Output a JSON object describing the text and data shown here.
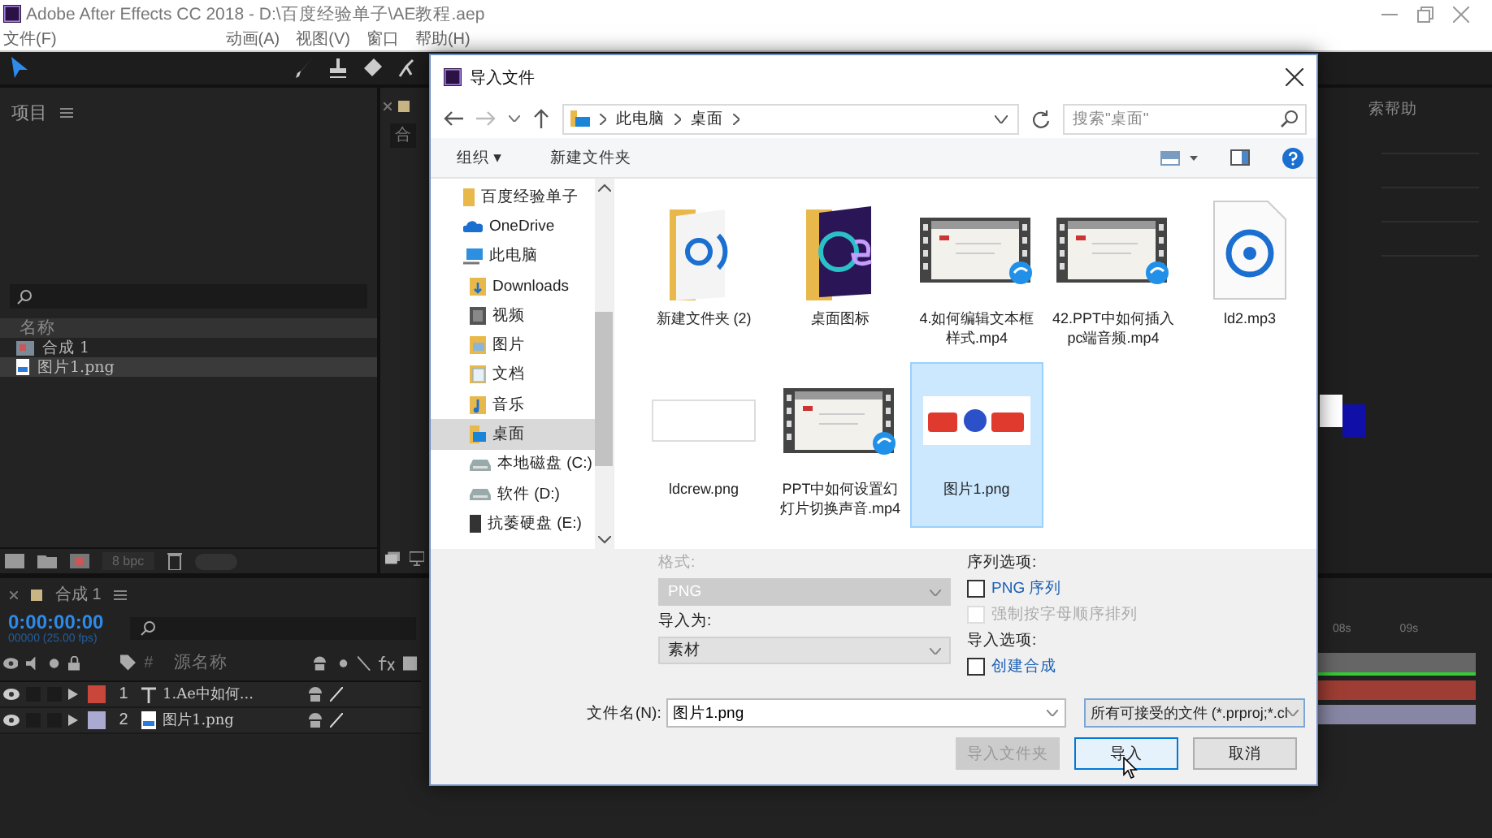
{
  "app": {
    "title": "Adobe After Effects CC 2018 - D:\\百度经验单子\\AE教程.aep"
  },
  "menu": [
    "文件(F)",
    "动画(A)",
    "视图(V)",
    "窗口",
    "帮助(H)"
  ],
  "project_panel": {
    "title": "项目",
    "columns": [
      "名称"
    ],
    "items": [
      {
        "name": "合成 1",
        "kind": "comp",
        "selected": false
      },
      {
        "name": "图片1.png",
        "kind": "image",
        "selected": true
      }
    ],
    "bit_depth": "8 bpc"
  },
  "comp_tab": "合",
  "right_panel": {
    "help_text": "索帮助",
    "ruler": [
      "08s",
      "09s"
    ]
  },
  "timeline": {
    "tab": "合成 1",
    "timecode": "0:00:00:00",
    "fps": "00000 (25.00 fps)",
    "columns": [
      "#",
      "源名称"
    ],
    "layers": [
      {
        "index": "1",
        "name": "1.Ae中如何...",
        "kind": "text",
        "color": "#c8473a"
      },
      {
        "index": "2",
        "name": "图片1.png",
        "kind": "image",
        "color": "#a9a9d2"
      }
    ]
  },
  "dialog": {
    "title": "导入文件",
    "breadcrumb": [
      "此电脑",
      "桌面"
    ],
    "search": {
      "placeholder": "搜索\"桌面\""
    },
    "toolbar": [
      "组织 ▾",
      "新建文件夹"
    ],
    "nav": [
      {
        "label": "百度经验单子",
        "kind": "folder",
        "selected": false
      },
      {
        "label": "OneDrive",
        "kind": "cloud",
        "selected": false
      },
      {
        "label": "此电脑",
        "kind": "pc",
        "selected": false,
        "children": [
          {
            "label": "Downloads",
            "kind": "download",
            "selected": false
          },
          {
            "label": "视频",
            "kind": "video",
            "selected": false
          },
          {
            "label": "图片",
            "kind": "picture",
            "selected": false
          },
          {
            "label": "文档",
            "kind": "document",
            "selected": false
          },
          {
            "label": "音乐",
            "kind": "music",
            "selected": false
          },
          {
            "label": "桌面",
            "kind": "desktop",
            "selected": true
          },
          {
            "label": "本地磁盘 (C:)",
            "kind": "drive",
            "selected": false
          },
          {
            "label": "软件 (D:)",
            "kind": "drive",
            "selected": false
          },
          {
            "label": "抗萎硬盘 (E:)",
            "kind": "disk",
            "selected": false
          }
        ]
      }
    ],
    "files": [
      {
        "name": "新建文件夹 (2)",
        "kind": "folder-doc",
        "selected": false
      },
      {
        "name": "桌面图标",
        "kind": "folder-app",
        "selected": false
      },
      {
        "name": "4.如何编辑文本框样式.mp4",
        "kind": "video",
        "selected": false
      },
      {
        "name": "42.PPT中如何插入pc端音频.mp4",
        "kind": "video",
        "selected": false
      },
      {
        "name": "ld2.mp3",
        "kind": "audio",
        "selected": false
      },
      {
        "name": "ldcrew.png",
        "kind": "blank-image",
        "selected": false
      },
      {
        "name": "PPT中如何设置幻灯片切换声音.mp4",
        "kind": "video",
        "selected": false
      },
      {
        "name": "图片1.png",
        "kind": "logo-image",
        "selected": true
      }
    ],
    "format_label": "格式:",
    "format": {
      "value": "PNG",
      "disabled": true
    },
    "import_as_label": "导入为:",
    "import_as": {
      "value": "素材",
      "disabled": false
    },
    "sequence_label": "序列选项:",
    "sequence_options": [
      {
        "label": "PNG 序列",
        "checked": false,
        "disabled": false
      },
      {
        "label": "强制按字母顺序排列",
        "checked": false,
        "disabled": true
      }
    ],
    "import_options_label": "导入选项:",
    "import_options": [
      {
        "label": "创建合成",
        "checked": false,
        "disabled": false
      }
    ],
    "filename_label": "文件名(N):",
    "filename": "图片1.png",
    "filter": "所有可接受的文件 (*.prproj;*.cl",
    "buttons": [
      {
        "label": "导入文件夹",
        "disabled": true,
        "default": false
      },
      {
        "label": "导入",
        "disabled": false,
        "default": true
      },
      {
        "label": "取消",
        "disabled": false,
        "default": false
      }
    ]
  }
}
